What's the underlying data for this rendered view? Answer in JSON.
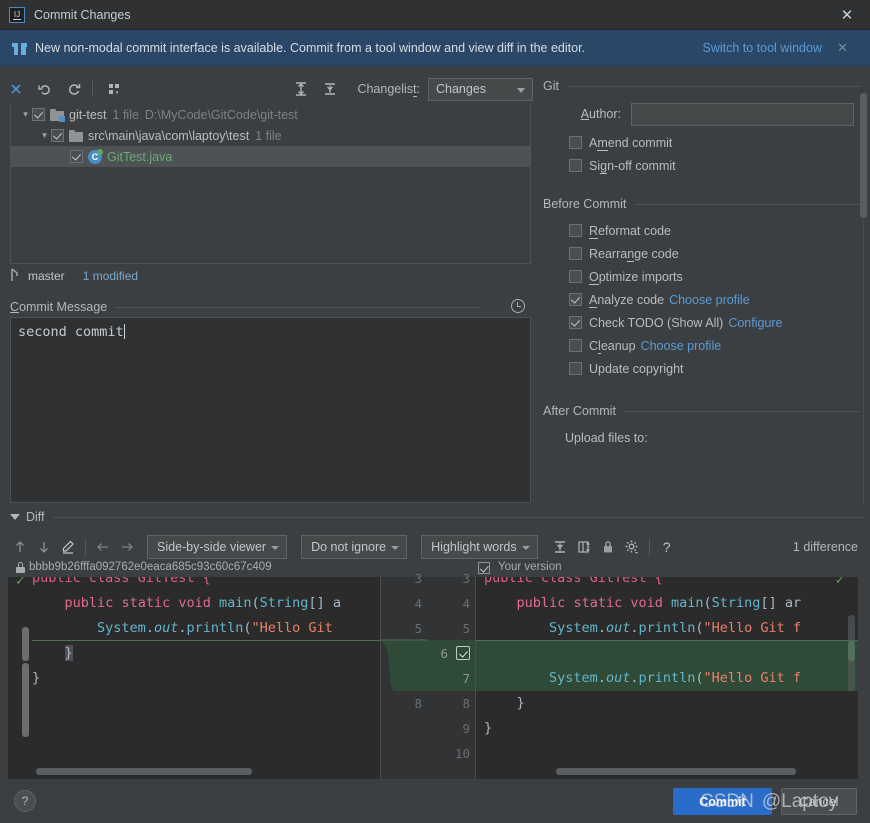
{
  "window": {
    "title": "Commit Changes",
    "app_icon": "intellij-idea-icon",
    "close_label": "✕"
  },
  "banner": {
    "icon": "gift-icon",
    "text": "New non-modal commit interface is available. Commit from a tool window and view diff in the editor.",
    "link": "Switch to tool window",
    "dismiss": "✕",
    "bg_color": "#2b4768",
    "link_color": "#5b9bd5"
  },
  "toolbar": {
    "icons": [
      {
        "name": "magic-wand-icon",
        "glyph": "✦"
      },
      {
        "name": "rollback-icon",
        "glyph": "↺"
      },
      {
        "name": "refresh-icon",
        "glyph": "↻"
      },
      {
        "name": "group-by-icon",
        "glyph": "∷"
      },
      {
        "name": "expand-all-icon",
        "glyph": "↧"
      },
      {
        "name": "collapse-all-icon",
        "glyph": "↥"
      }
    ],
    "changelist_label": "Changelist:",
    "changelist_value": "Changes"
  },
  "tree": {
    "rows": [
      {
        "indent": 0,
        "twisty": "▼",
        "checked": true,
        "icon": "module-folder-icon",
        "label": "git-test",
        "count": "1 file",
        "path": "D:\\MyCode\\GitCode\\git-test",
        "selected": false,
        "green": false
      },
      {
        "indent": 1,
        "twisty": "▼",
        "checked": true,
        "icon": "folder-icon",
        "label": "src\\main\\java\\com\\laptoy\\test",
        "count": "1 file",
        "path": "",
        "selected": false,
        "green": false
      },
      {
        "indent": 2,
        "twisty": "",
        "checked": true,
        "icon": "java-class-icon",
        "label": "GitTest.java",
        "count": "",
        "path": "",
        "selected": true,
        "green": true
      }
    ]
  },
  "branch": {
    "icon": "git-branch-icon",
    "name": "master",
    "modified": "1 modified"
  },
  "commit_message": {
    "section_title": "Commit Message",
    "value": "second commit",
    "history_icon": "clock-icon"
  },
  "options": {
    "git": {
      "title": "Git",
      "author_label": "Author:",
      "author_value": "",
      "checkboxes": [
        {
          "label_pre": "A",
          "label_u": "m",
          "label_post": "end commit",
          "label": "Amend commit",
          "checked": false
        },
        {
          "label_pre": "Si",
          "label_u": "g",
          "label_post": "n-off commit",
          "label": "Sign-off commit",
          "checked": false
        }
      ]
    },
    "before_commit": {
      "title": "Before Commit",
      "checkboxes": [
        {
          "label": "Reformat code",
          "checked": false,
          "link": ""
        },
        {
          "label": "Rearrange code",
          "checked": false,
          "link": ""
        },
        {
          "label": "Optimize imports",
          "checked": false,
          "link": ""
        },
        {
          "label": "Analyze code",
          "checked": true,
          "link": "Choose profile"
        },
        {
          "label": "Check TODO (Show All)",
          "checked": true,
          "link": "Configure"
        },
        {
          "label": "Cleanup",
          "checked": false,
          "link": "Choose profile"
        },
        {
          "label": "Update copyright",
          "checked": false,
          "link": ""
        }
      ]
    },
    "after_commit": {
      "title": "After Commit",
      "upload_label": "Upload files to:"
    }
  },
  "diff": {
    "section_title": "Diff",
    "toolbar": {
      "prev_icon": "arrow-up-icon",
      "next_icon": "arrow-down-icon",
      "edit_icon": "pencil-icon",
      "left_icon": "arrow-left-icon",
      "right_icon": "arrow-right-icon",
      "viewer_mode": "Side-by-side viewer",
      "ignore_mode": "Do not ignore",
      "highlight_mode": "Highlight words",
      "collapse_icon": "collapse-unchanged-icon",
      "whitespace_icon": "show-whitespace-icon",
      "lock_icon": "readonly-lock-icon",
      "settings_icon": "gear-icon",
      "help_icon": "help-icon",
      "difference_count": "1 difference"
    },
    "left_header": {
      "lock_icon": "lock-icon",
      "revision": "bbbb9b26fffa092762e0eaca685c93c60c67c409"
    },
    "right_header": {
      "checked": true,
      "label": "Your version"
    },
    "left_lines": [
      {
        "num": "3",
        "text": "public class GitTest {",
        "tokens": [
          {
            "t": "public class GitTest {",
            "c": "pk"
          }
        ]
      },
      {
        "num": "4",
        "text": "    public static void main(String[] a",
        "tokens": []
      },
      {
        "num": "5",
        "text": "        System.out.println(\"Hello Git",
        "tokens": []
      },
      {
        "num": "6",
        "text": "    }",
        "tokens": []
      },
      {
        "num": "7",
        "text": "}",
        "tokens": []
      },
      {
        "num": "8",
        "text": "",
        "tokens": []
      }
    ],
    "right_lines": [
      {
        "num": "3",
        "text": "public class GitTest {"
      },
      {
        "num": "4",
        "text": "    public static void main(String[] ar"
      },
      {
        "num": "5",
        "text": "        System.out.println(\"Hello Git f"
      },
      {
        "num": "6",
        "text": ""
      },
      {
        "num": "7",
        "text": "        System.out.println(\"Hello Git f"
      },
      {
        "num": "8",
        "text": "    }"
      },
      {
        "num": "9",
        "text": "}"
      },
      {
        "num": "10",
        "text": ""
      }
    ],
    "accept_change_checkbox": true,
    "added_color": "#2f4a36"
  },
  "footer": {
    "help_label": "?",
    "commit_label": "Commit",
    "cancel_label": "Cancel",
    "commit_color": "#2a6cc9"
  },
  "watermark": {
    "brand": "CSDN",
    "handle": "@Laptoy"
  }
}
